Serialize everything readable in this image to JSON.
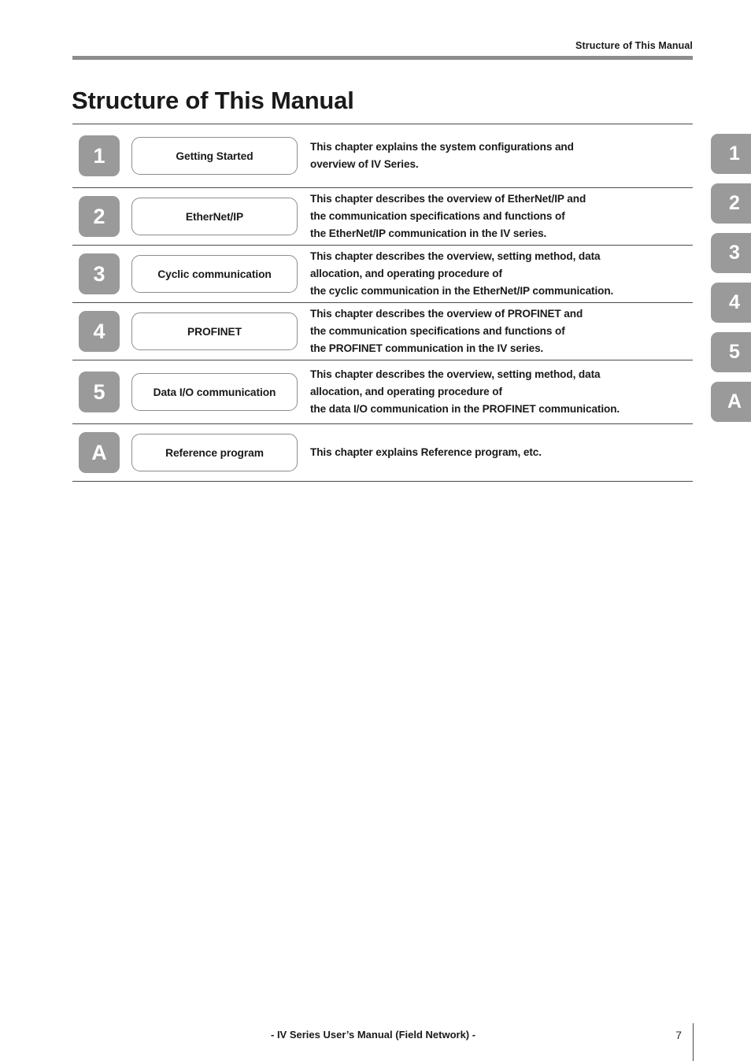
{
  "header": {
    "running_title": "Structure of This Manual"
  },
  "title": "Structure of This Manual",
  "chapters": [
    {
      "badge": "1",
      "name": "Getting Started",
      "description": "This chapter explains the system configurations and\noverview of IV Series."
    },
    {
      "badge": "2",
      "name": "EtherNet/IP",
      "description": "This chapter describes the overview of EtherNet/IP and\nthe communication specifications and functions of\nthe EtherNet/IP communication in the IV series."
    },
    {
      "badge": "3",
      "name": "Cyclic communication",
      "description": "This chapter describes the overview, setting method, data\nallocation, and operating procedure of\nthe cyclic communication in the EtherNet/IP communication."
    },
    {
      "badge": "4",
      "name": "PROFINET",
      "description": "This chapter describes the overview of PROFINET and\nthe communication specifications and functions of\nthe PROFINET communication in the IV series."
    },
    {
      "badge": "5",
      "name": "Data I/O communication",
      "description": "This chapter describes the overview, setting method, data\nallocation, and operating procedure of\nthe data I/O communication in the PROFINET communication."
    },
    {
      "badge": "A",
      "name": "Reference program",
      "description": "This chapter explains Reference program, etc."
    }
  ],
  "side_tabs": [
    "1",
    "2",
    "3",
    "4",
    "5",
    "A"
  ],
  "footer": {
    "caption": "- IV Series User’s Manual (Field Network) -",
    "page_number": "7"
  },
  "colors": {
    "badge_gray": "#9a9a9a",
    "header_rule_gray": "#8d8d8d",
    "rule_dark": "#4a4a4a",
    "text_dark": "#1a1a1a"
  }
}
